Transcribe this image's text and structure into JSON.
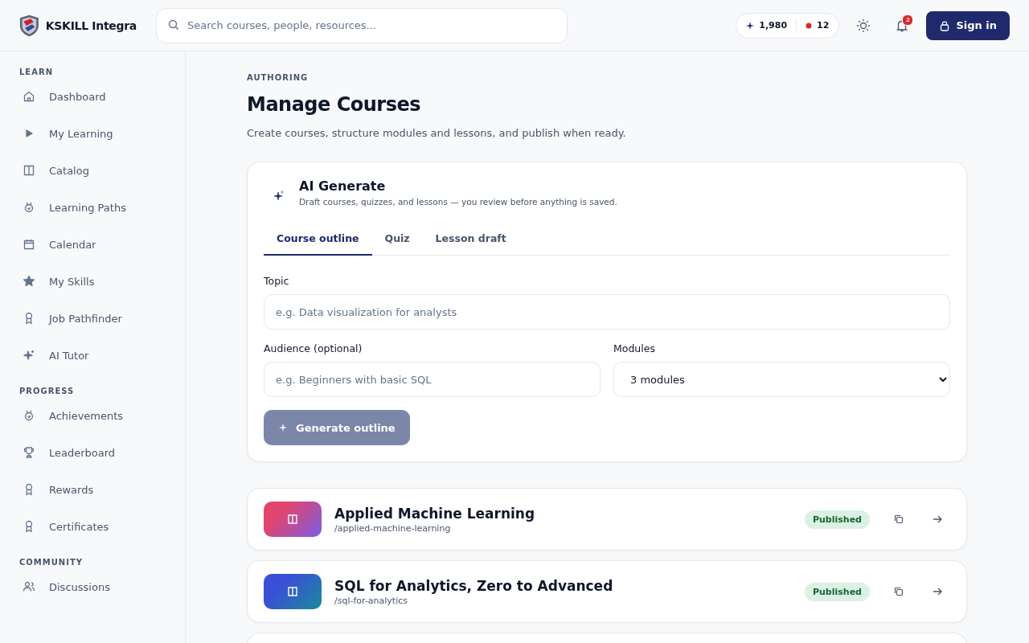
{
  "brand": {
    "name": "KSKILL Integra"
  },
  "search": {
    "placeholder": "Search courses, people, resources..."
  },
  "stats": {
    "points": "1,980",
    "streak": "12"
  },
  "notifications": {
    "count": "2"
  },
  "sign_in": "Sign in",
  "sidebar": {
    "sections": [
      {
        "title": "LEARN",
        "items": [
          {
            "label": "Dashboard"
          },
          {
            "label": "My Learning"
          },
          {
            "label": "Catalog"
          },
          {
            "label": "Learning Paths"
          },
          {
            "label": "Calendar"
          },
          {
            "label": "My Skills"
          },
          {
            "label": "Job Pathfinder"
          },
          {
            "label": "AI Tutor"
          }
        ]
      },
      {
        "title": "PROGRESS",
        "items": [
          {
            "label": "Achievements"
          },
          {
            "label": "Leaderboard"
          },
          {
            "label": "Rewards"
          },
          {
            "label": "Certificates"
          }
        ]
      },
      {
        "title": "COMMUNITY",
        "items": [
          {
            "label": "Discussions"
          }
        ]
      }
    ]
  },
  "page": {
    "eyebrow": "AUTHORING",
    "title": "Manage Courses",
    "subtitle": "Create courses, structure modules and lessons, and publish when ready."
  },
  "ai_generate": {
    "title": "AI Generate",
    "subtitle": "Draft courses, quizzes, and lessons — you review before anything is saved.",
    "tabs": [
      {
        "label": "Course outline",
        "selected": true
      },
      {
        "label": "Quiz",
        "selected": false
      },
      {
        "label": "Lesson draft",
        "selected": false
      }
    ],
    "topic": {
      "label": "Topic",
      "placeholder": "e.g. Data visualization for analysts"
    },
    "audience": {
      "label": "Audience (optional)",
      "placeholder": "e.g. Beginners with basic SQL"
    },
    "modules": {
      "label": "Modules",
      "value": "3 modules"
    },
    "button": {
      "label": "Generate outline",
      "disabled": true
    }
  },
  "courses": [
    {
      "title": "Applied Machine Learning",
      "slug": "/applied-machine-learning",
      "status": "Published",
      "color": "#e0456e"
    },
    {
      "title": "SQL for Analytics, Zero to Advanced",
      "slug": "/sql-for-analytics",
      "status": "Published",
      "color": "#3b4fd6"
    }
  ]
}
